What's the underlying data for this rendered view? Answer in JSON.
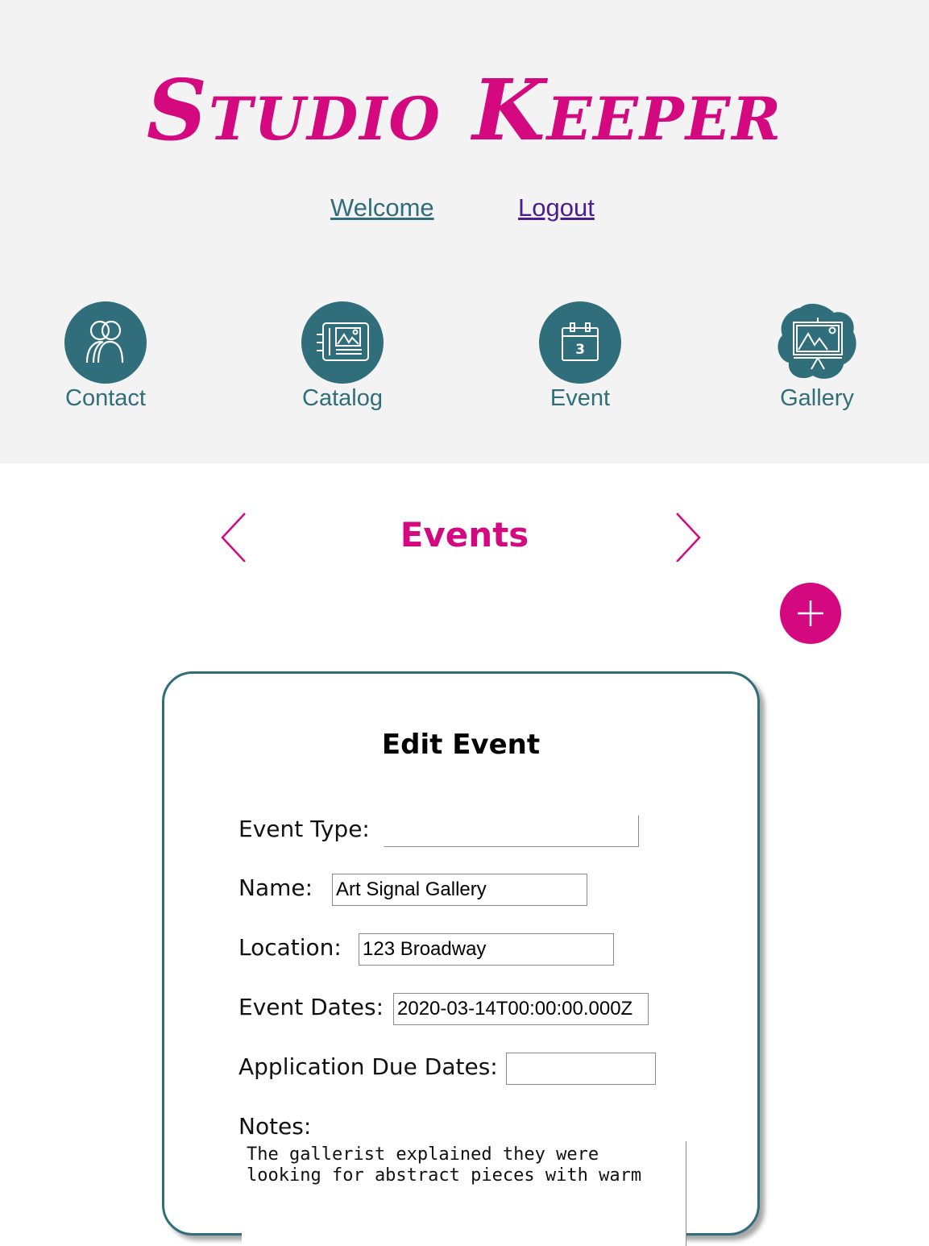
{
  "app": {
    "title": "Studio Keeper",
    "brand_color": "#d4087f",
    "accent_color": "#2f6e7a"
  },
  "top_links": {
    "welcome": "Welcome",
    "logout": "Logout"
  },
  "nav": {
    "items": [
      {
        "label": "Contact",
        "icon": "contacts-icon"
      },
      {
        "label": "Catalog",
        "icon": "catalog-icon"
      },
      {
        "label": "Event",
        "icon": "calendar-icon"
      },
      {
        "label": "Gallery",
        "icon": "gallery-easel-icon"
      }
    ],
    "calendar_day": "3"
  },
  "section": {
    "title": "Events",
    "prev_icon": "chevron-left-icon",
    "next_icon": "chevron-right-icon",
    "add_icon": "plus-icon"
  },
  "form": {
    "title": "Edit Event",
    "fields": {
      "event_type": {
        "label": "Event Type:",
        "value": ""
      },
      "name": {
        "label": "Name:",
        "value": "Art Signal Gallery"
      },
      "location": {
        "label": "Location:",
        "value": "123 Broadway"
      },
      "event_dates": {
        "label": "Event Dates:",
        "value": "2020-03-14T00:00:00.000Z"
      },
      "application_due_dates": {
        "label": "Application Due Dates:",
        "value": ""
      },
      "notes": {
        "label": "Notes:",
        "value": "The gallerist explained they were looking for abstract pieces with warm"
      }
    }
  }
}
